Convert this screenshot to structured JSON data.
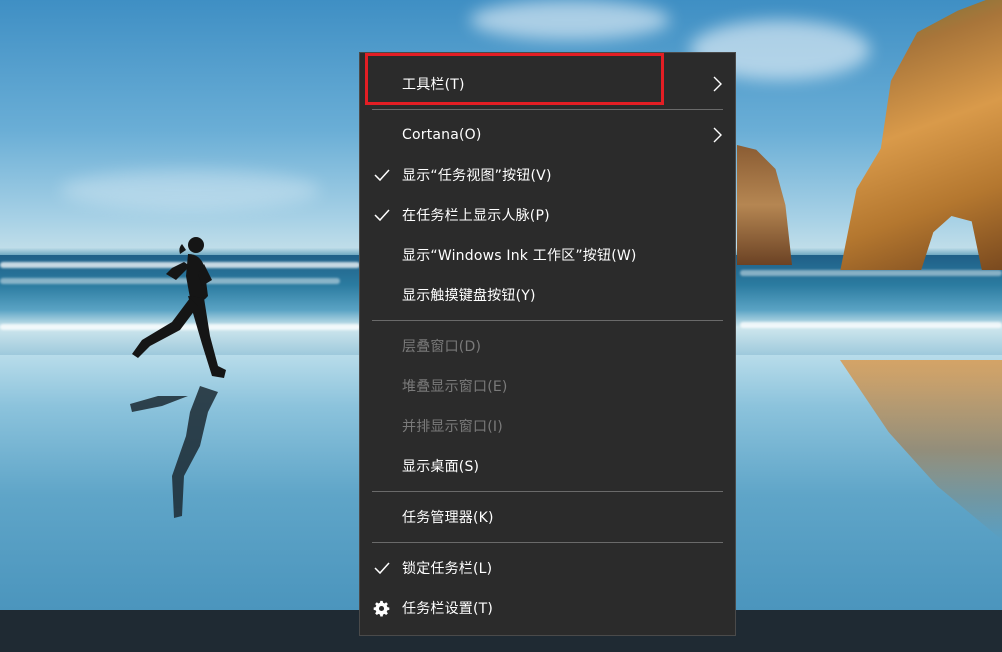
{
  "menu": {
    "items": [
      {
        "label": "工具栏(T)",
        "checked": false,
        "submenu": true,
        "disabled": false,
        "icon": "chevron-right-icon"
      },
      {
        "label": "Cortana(O)",
        "checked": false,
        "submenu": true,
        "disabled": false,
        "icon": "chevron-right-icon"
      },
      {
        "label": "显示“任务视图”按钮(V)",
        "checked": true,
        "submenu": false,
        "disabled": false,
        "icon": "checkmark-icon"
      },
      {
        "label": "在任务栏上显示人脉(P)",
        "checked": true,
        "submenu": false,
        "disabled": false,
        "icon": "checkmark-icon"
      },
      {
        "label": "显示“Windows Ink 工作区”按钮(W)",
        "checked": false,
        "submenu": false,
        "disabled": false
      },
      {
        "label": "显示触摸键盘按钮(Y)",
        "checked": false,
        "submenu": false,
        "disabled": false
      },
      {
        "label": "层叠窗口(D)",
        "checked": false,
        "submenu": false,
        "disabled": true
      },
      {
        "label": "堆叠显示窗口(E)",
        "checked": false,
        "submenu": false,
        "disabled": true
      },
      {
        "label": "并排显示窗口(I)",
        "checked": false,
        "submenu": false,
        "disabled": true
      },
      {
        "label": "显示桌面(S)",
        "checked": false,
        "submenu": false,
        "disabled": false
      },
      {
        "label": "任务管理器(K)",
        "checked": false,
        "submenu": false,
        "disabled": false
      },
      {
        "label": "锁定任务栏(L)",
        "checked": true,
        "submenu": false,
        "disabled": false,
        "icon": "checkmark-icon"
      },
      {
        "label": "任务栏设置(T)",
        "checked": false,
        "submenu": false,
        "disabled": false,
        "icon": "gear-icon"
      }
    ]
  },
  "colors": {
    "menu_bg": "#2b2b2b",
    "menu_text": "#ffffff",
    "disabled_text": "#7a7a7a",
    "separator": "#6a6a6a",
    "highlight_border": "#e31e24",
    "taskbar": "#1f2a33"
  }
}
